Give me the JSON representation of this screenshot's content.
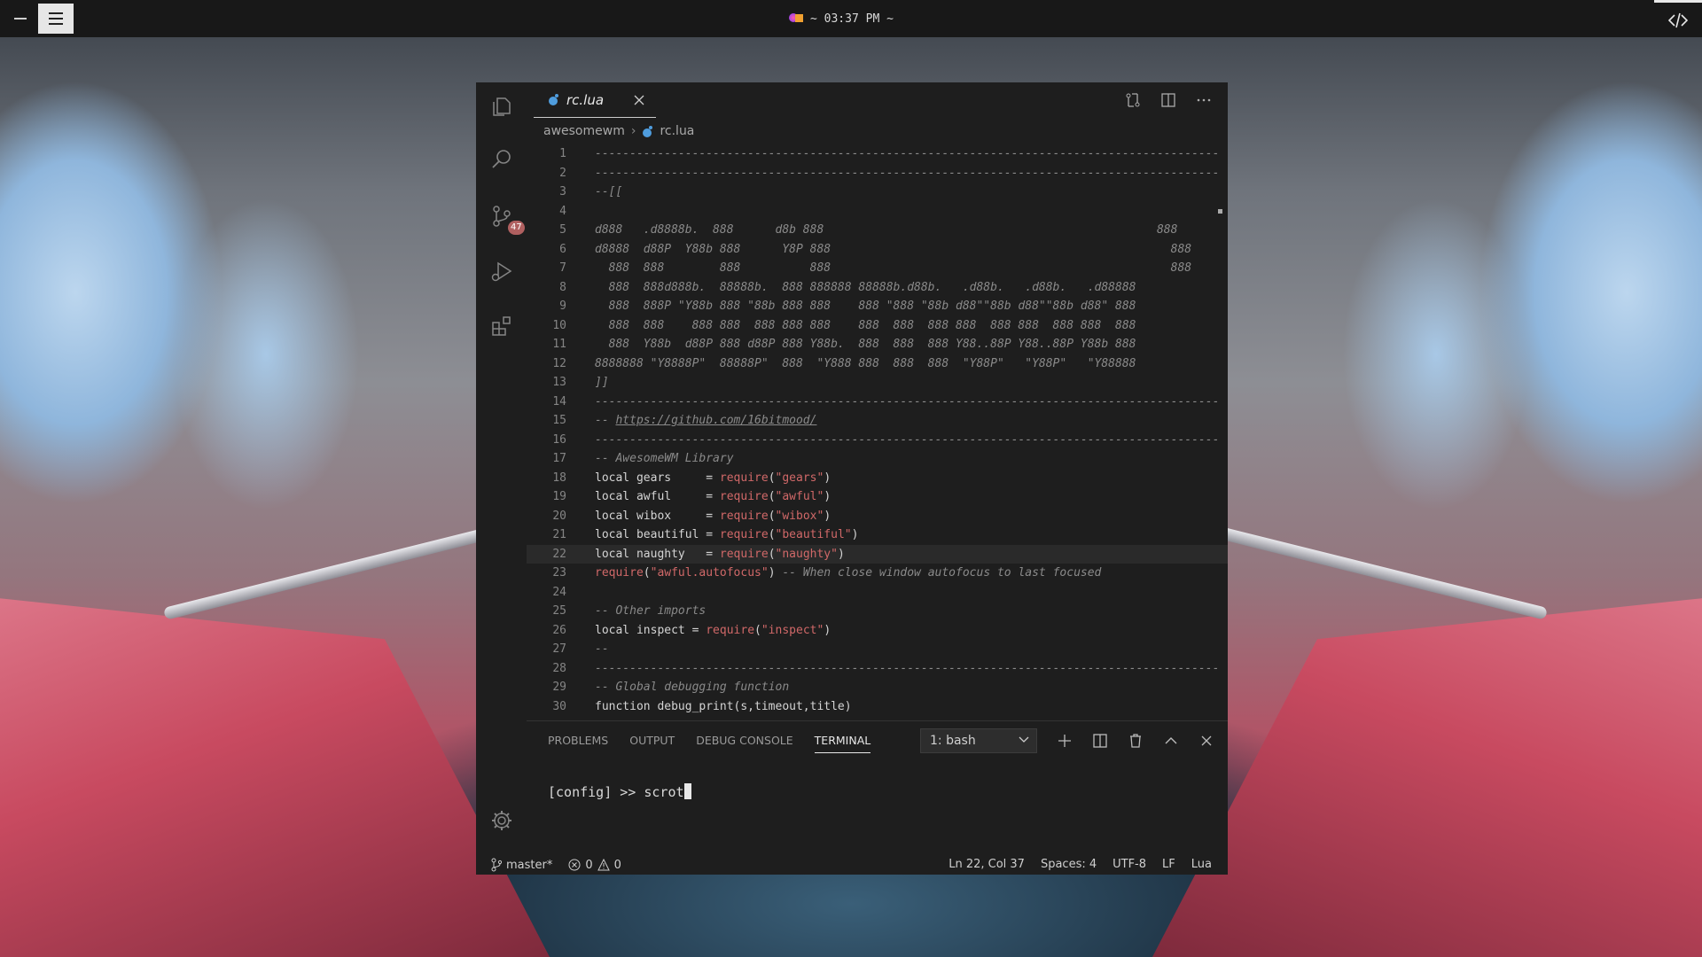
{
  "topbar": {
    "clock": "~ 03:37 PM ~"
  },
  "editor": {
    "tab_label": "rc.lua",
    "breadcrumb": [
      "awesomewm",
      "rc.lua"
    ],
    "scm_badge": "47",
    "lines": [
      {
        "n": "1",
        "t": "------------------------------------------------------------------------------------------",
        "k": "cm"
      },
      {
        "n": "2",
        "t": "------------------------------------------------------------------------------------------",
        "k": "cm"
      },
      {
        "n": "3",
        "t": "--[[",
        "k": "cm"
      },
      {
        "n": "4",
        "t": "",
        "k": "cm"
      },
      {
        "n": "5",
        "t": "d888   .d8888b.  888      d8b 888                                                888",
        "k": "cm"
      },
      {
        "n": "6",
        "t": "d8888  d88P  Y88b 888      Y8P 888                                                 888",
        "k": "cm"
      },
      {
        "n": "7",
        "t": "  888  888        888          888                                                 888",
        "k": "cm"
      },
      {
        "n": "8",
        "t": "  888  888d888b.  88888b.  888 888888 88888b.d88b.   .d88b.   .d88b.   .d88888",
        "k": "cm"
      },
      {
        "n": "9",
        "t": "  888  888P \"Y88b 888 \"88b 888 888    888 \"888 \"88b d88\"\"88b d88\"\"88b d88\" 888",
        "k": "cm"
      },
      {
        "n": "10",
        "t": "  888  888    888 888  888 888 888    888  888  888 888  888 888  888 888  888",
        "k": "cm"
      },
      {
        "n": "11",
        "t": "  888  Y88b  d88P 888 d88P 888 Y88b.  888  888  888 Y88..88P Y88..88P Y88b 888",
        "k": "cm"
      },
      {
        "n": "12",
        "t": "8888888 \"Y8888P\"  88888P\"  888  \"Y888 888  888  888  \"Y88P\"   \"Y88P\"   \"Y88888",
        "k": "cm"
      },
      {
        "n": "13",
        "t": "]]",
        "k": "cm"
      },
      {
        "n": "14",
        "t": "------------------------------------------------------------------------------------------",
        "k": "cm"
      },
      {
        "n": "15",
        "t": "-- ",
        "k": "cm",
        "link": "https://github.com/16bitmood/"
      },
      {
        "n": "16",
        "t": "------------------------------------------------------------------------------------------",
        "k": "cm"
      },
      {
        "n": "17",
        "t": "-- AwesomeWM Library",
        "k": "cm"
      },
      {
        "n": "18",
        "parts": [
          [
            "kw",
            "local gears     = "
          ],
          [
            "fn",
            "require"
          ],
          [
            "kw",
            "("
          ],
          [
            "str",
            "\"gears\""
          ],
          [
            "kw",
            ")"
          ]
        ]
      },
      {
        "n": "19",
        "parts": [
          [
            "kw",
            "local awful     = "
          ],
          [
            "fn",
            "require"
          ],
          [
            "kw",
            "("
          ],
          [
            "str",
            "\"awful\""
          ],
          [
            "kw",
            ")"
          ]
        ]
      },
      {
        "n": "20",
        "parts": [
          [
            "kw",
            "local wibox     = "
          ],
          [
            "fn",
            "require"
          ],
          [
            "kw",
            "("
          ],
          [
            "str",
            "\"wibox\""
          ],
          [
            "kw",
            ")"
          ]
        ]
      },
      {
        "n": "21",
        "parts": [
          [
            "kw",
            "local beautiful = "
          ],
          [
            "fn",
            "require"
          ],
          [
            "kw",
            "("
          ],
          [
            "str",
            "\"beautiful\""
          ],
          [
            "kw",
            ")"
          ]
        ]
      },
      {
        "n": "22",
        "hl": true,
        "parts": [
          [
            "kw",
            "local naughty   = "
          ],
          [
            "fn",
            "require"
          ],
          [
            "kw",
            "("
          ],
          [
            "str",
            "\"naughty\""
          ],
          [
            "kw",
            ")"
          ]
        ]
      },
      {
        "n": "23",
        "parts": [
          [
            "fn",
            "require"
          ],
          [
            "kw",
            "("
          ],
          [
            "str",
            "\"awful.autofocus\""
          ],
          [
            "kw",
            ") "
          ],
          [
            "cm",
            "-- When close window autofocus to last focused"
          ]
        ]
      },
      {
        "n": "24",
        "t": "",
        "k": "cm"
      },
      {
        "n": "25",
        "t": "-- Other imports",
        "k": "cm"
      },
      {
        "n": "26",
        "parts": [
          [
            "kw",
            "local inspect = "
          ],
          [
            "fn",
            "require"
          ],
          [
            "kw",
            "("
          ],
          [
            "str",
            "\"inspect\""
          ],
          [
            "kw",
            ")"
          ]
        ]
      },
      {
        "n": "27",
        "t": "--",
        "k": "cm"
      },
      {
        "n": "28",
        "t": "------------------------------------------------------------------------------------------",
        "k": "cm"
      },
      {
        "n": "29",
        "t": "-- Global debugging function",
        "k": "cm"
      },
      {
        "n": "30",
        "parts": [
          [
            "kw",
            "function debug_print(s,timeout,title)"
          ]
        ]
      }
    ]
  },
  "panel": {
    "tabs": [
      "PROBLEMS",
      "OUTPUT",
      "DEBUG CONSOLE",
      "TERMINAL"
    ],
    "active_tab": "TERMINAL",
    "terminal_select": "1: bash",
    "terminal_line": "[config] >> scrot"
  },
  "status": {
    "branch": "master*",
    "errors": "0",
    "warnings": "0",
    "position": "Ln 22, Col 37",
    "spaces": "Spaces: 4",
    "encoding": "UTF-8",
    "eol": "LF",
    "language": "Lua"
  },
  "colors": {
    "editor_bg": "#1e1e1e",
    "string": "#d06868",
    "comment": "#8a8a8a"
  }
}
